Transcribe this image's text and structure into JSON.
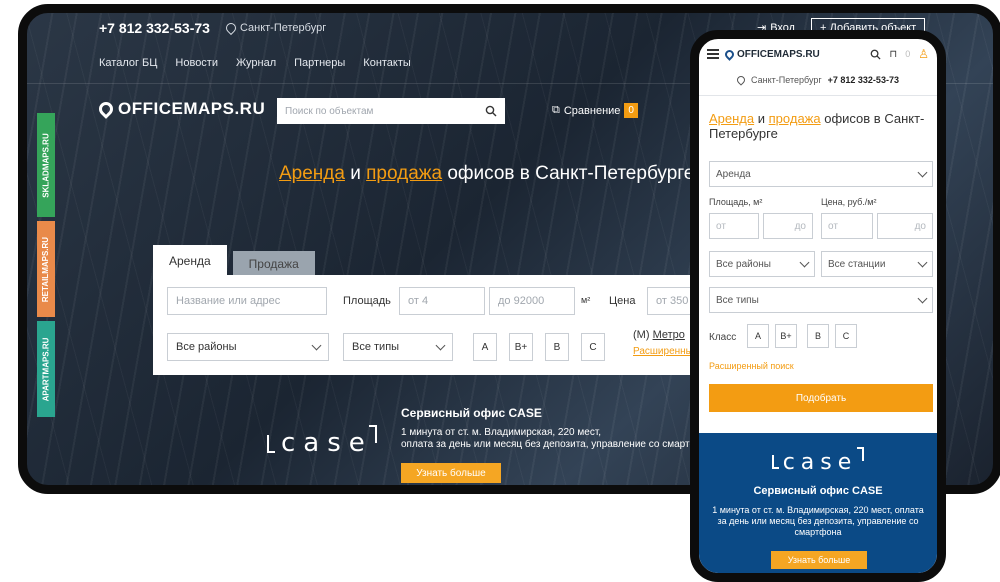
{
  "desktop": {
    "topbar": {
      "phone": "+7 812 332-53-73",
      "city": "Санкт-Петербург",
      "login": "Вход",
      "add_object": "+ Добавить объект"
    },
    "nav": [
      "Каталог БЦ",
      "Новости",
      "Журнал",
      "Партнеры",
      "Контакты"
    ],
    "logo": "OFFICEMAPS.RU",
    "search_placeholder": "Поиск по объектам",
    "compare_label": "Сравнение",
    "compare_count": "0",
    "hero": {
      "part1": "Аренда",
      "part2": " и ",
      "part3": "продажа",
      "part4": " офисов в Санкт-Петербурге"
    },
    "tabs": {
      "rent": "Аренда",
      "sale": "Продажа"
    },
    "form": {
      "name_placeholder": "Название или адрес",
      "area_label": "Площадь",
      "area_from": "от 4",
      "area_to": "до 92000",
      "area_unit": "м²",
      "price_label": "Цена",
      "price_from": "от 350",
      "district": "Все районы",
      "type": "Все типы",
      "classes": [
        "A",
        "B+",
        "B",
        "C"
      ],
      "metro_icon": "(M)",
      "metro": "Метро",
      "advanced": "Расширенный поиск"
    },
    "side_tabs": [
      "SKLADMAPS.RU",
      "RETAILMAPS.RU",
      "APARTMAPS.RU"
    ],
    "side_colors": [
      "#35a45a",
      "#e98a4a",
      "#2aa58f"
    ],
    "banner": {
      "logo": "case",
      "title": "Сервисный офис CASE",
      "line1": "1 минута от ст. м. Владимирская, 220 мест,",
      "line2": "оплата за день или месяц без депозита, управление со смартфона",
      "button": "Узнать больше"
    }
  },
  "mobile": {
    "logo": "OFFICEMAPS.RU",
    "fav_count": "0",
    "city": "Санкт-Петербург",
    "phone": "+7 812 332-53-73",
    "title": {
      "part1": "Аренда",
      "part2": " и ",
      "part3": "продажа",
      "part4": " офисов в Санкт-Петербурге"
    },
    "deal_type": "Аренда",
    "area_label": "Площадь, м²",
    "price_label": "Цена, руб./м²",
    "from": "от",
    "to": "до",
    "district": "Все районы",
    "station": "Все станции",
    "type": "Все типы",
    "class_label": "Класс",
    "classes": [
      "A",
      "B+",
      "B",
      "C"
    ],
    "advanced": "Расширенный поиск",
    "submit": "Подобрать",
    "banner": {
      "logo": "case",
      "title": "Сервисный офис CASE",
      "text": "1 минута от ст. м. Владимирская, 220 мест, оплата за день или месяц без депозита, управление со смартфона",
      "button": "Узнать больше"
    }
  },
  "colors": {
    "accent": "#f39c12",
    "banner_blue": "#0b4a86"
  }
}
